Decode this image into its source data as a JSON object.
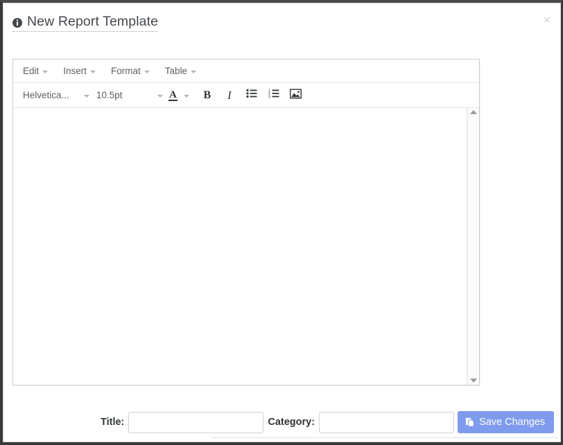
{
  "window": {
    "title": "New Report Template",
    "title_icon": "info-circle-icon",
    "close_label": "×"
  },
  "editor": {
    "menubar": [
      {
        "label": "Edit",
        "icon": "chevron-down-icon"
      },
      {
        "label": "Insert",
        "icon": "chevron-down-icon"
      },
      {
        "label": "Format",
        "icon": "chevron-down-icon"
      },
      {
        "label": "Table",
        "icon": "chevron-down-icon"
      }
    ],
    "toolbar": {
      "font_family": "Helvetica...",
      "font_size": "10.5pt",
      "text_color_label": "A",
      "bold_label": "B",
      "italic_label": "I",
      "buttons": [
        "text-color-icon",
        "bold-icon",
        "italic-icon",
        "bullet-list-icon",
        "numbered-list-icon",
        "insert-image-icon"
      ]
    },
    "content": "",
    "scrollbar": {
      "up_icon": "triangle-up-icon",
      "down_icon": "triangle-down-icon"
    }
  },
  "form": {
    "title_label": "Title:",
    "title_value": "",
    "title_placeholder": "",
    "category_label": "Category:",
    "category_value": "",
    "category_placeholder": "",
    "save_label": "Save Changes",
    "save_icon": "save-document-icon"
  },
  "colors": {
    "save_button_bg": "#7f9bee",
    "save_button_text": "#ffffff",
    "title_text": "#43484d",
    "menu_text": "#5b6166",
    "border": "#cccccc",
    "window_frame": "#3a3a3a"
  }
}
